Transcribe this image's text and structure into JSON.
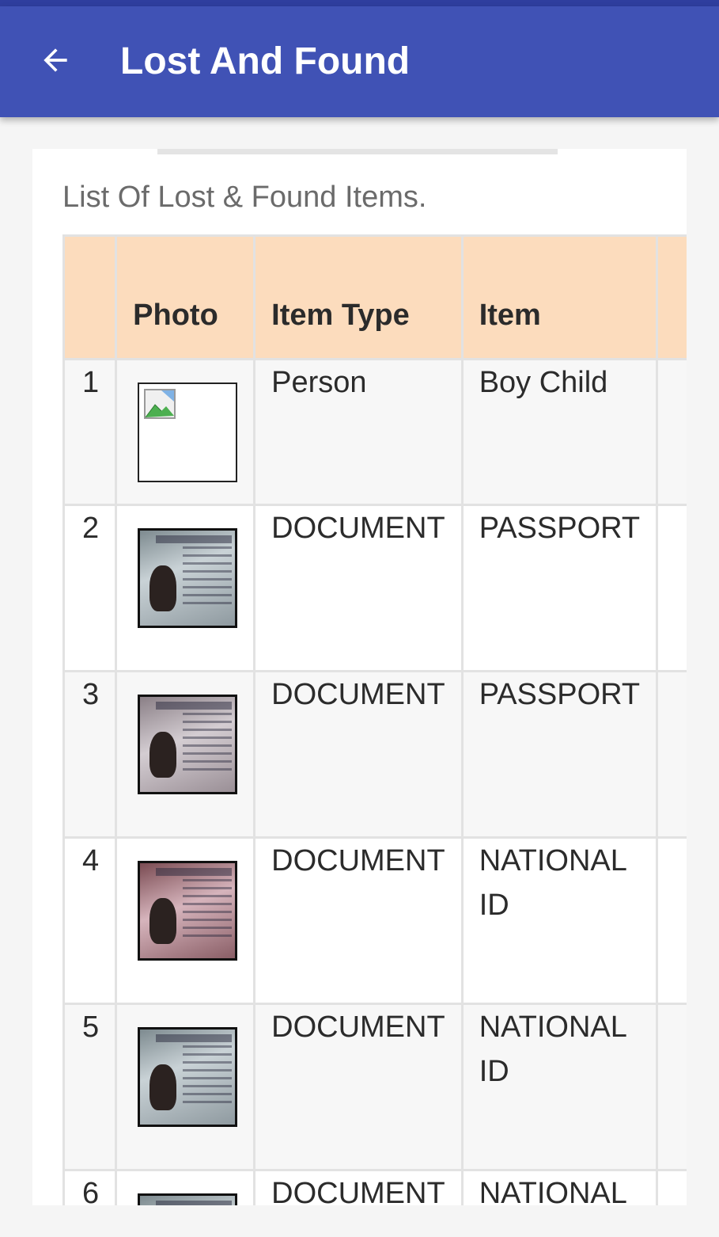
{
  "appbar": {
    "title": "Lost And Found",
    "back_icon": "arrow-back-icon",
    "color": "#4052b5"
  },
  "list": {
    "heading": "List Of Lost & Found Items."
  },
  "table": {
    "header_color": "#fcdcbd",
    "columns": [
      "",
      "Photo",
      "Item Type",
      "Item"
    ],
    "rows": [
      {
        "num": "1",
        "photo": "broken-image-icon",
        "item_type": "Person",
        "item": "Boy Child"
      },
      {
        "num": "2",
        "photo": "passport-photo",
        "item_type": "DOCUMENT",
        "item": "PASSPORT"
      },
      {
        "num": "3",
        "photo": "passport-photo",
        "item_type": "DOCUMENT",
        "item": "PASSPORT"
      },
      {
        "num": "4",
        "photo": "national-id-photo",
        "item_type": "DOCUMENT",
        "item": "NATIONAL ID"
      },
      {
        "num": "5",
        "photo": "national-id-photo",
        "item_type": "DOCUMENT",
        "item": "NATIONAL ID"
      },
      {
        "num": "6",
        "photo": "national-id-photo",
        "item_type": "DOCUMENT",
        "item": "NATIONAL"
      }
    ]
  }
}
